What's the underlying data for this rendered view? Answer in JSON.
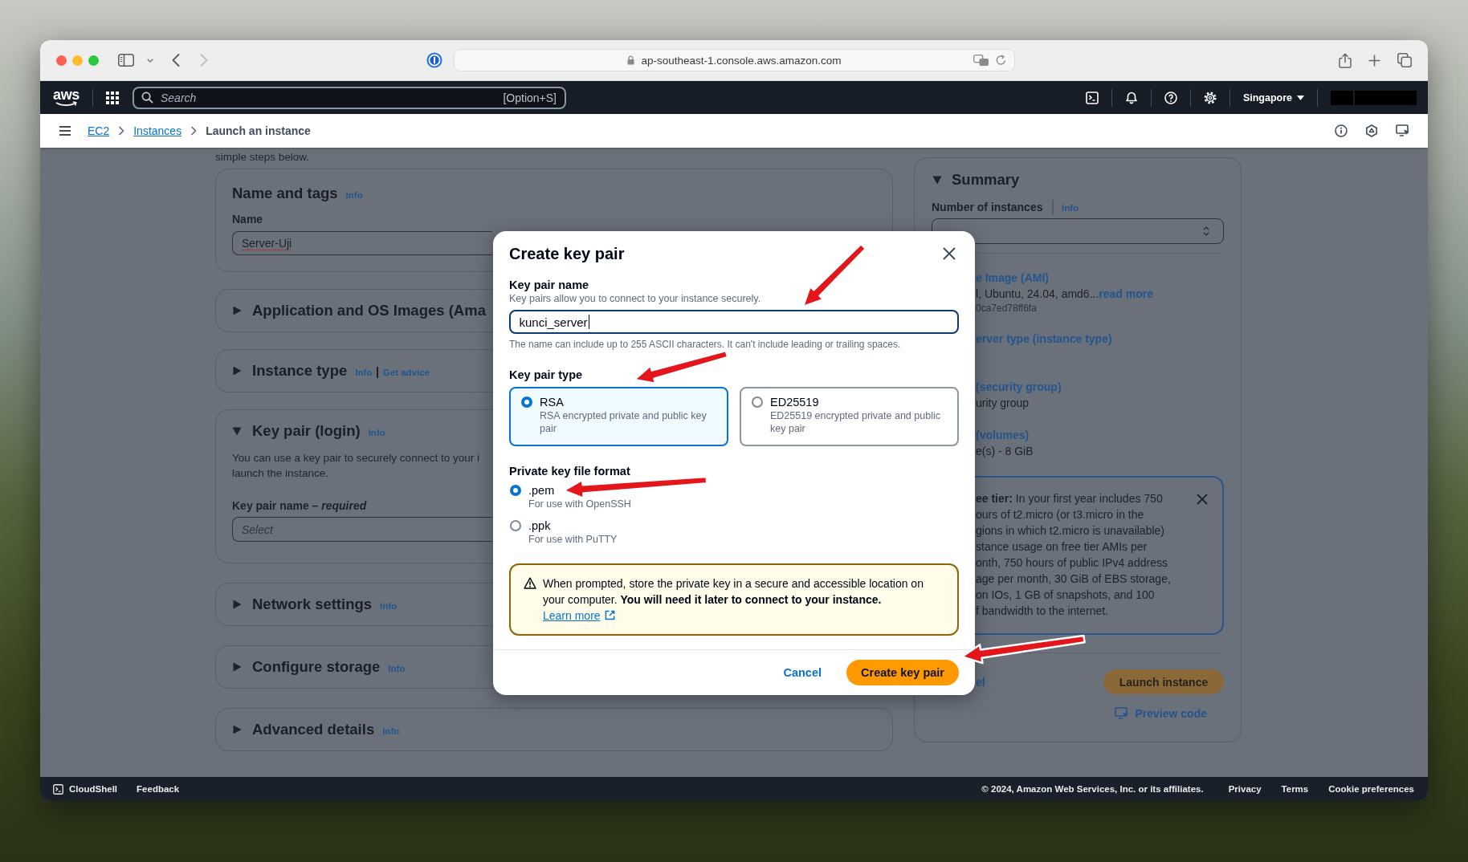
{
  "browser": {
    "nav_buttons": [
      {
        "kind": "back",
        "disabled": false
      },
      {
        "kind": "forward",
        "disabled": true
      }
    ],
    "url": "ap-southeast-1.console.aws.amazon.com"
  },
  "top_nav": {
    "logo": "aws",
    "search": {
      "placeholder": "Search",
      "shortcut": "[Option+S]"
    },
    "region": "Singapore"
  },
  "breadcrumbs": [
    {
      "label": "EC2",
      "kind": "link"
    },
    {
      "label": "Instances",
      "kind": "link"
    },
    {
      "label": "Launch an instance",
      "kind": "current"
    }
  ],
  "intro": "simple steps below.",
  "sections": [
    {
      "kind": "name",
      "title": "Name and tags",
      "info": "Info",
      "field_label": "Name",
      "value": "Server-Uji",
      "misspelled": true
    },
    {
      "kind": "collapsible",
      "title": "Application and OS Images (Ama",
      "expanded": false
    },
    {
      "kind": "collapsible",
      "title": "Instance type",
      "expanded": false,
      "info": "Info",
      "link": "Get advice"
    },
    {
      "kind": "collapsible",
      "title": "Key pair (login)",
      "expanded": true,
      "info": "Info",
      "description": [
        "You can use a key pair to securely connect to your i",
        "launch the instance."
      ],
      "field_label": "Key pair name – *required*",
      "placeholder": "Select"
    },
    {
      "kind": "collapsible",
      "title": "Network settings",
      "expanded": false,
      "info": "Info"
    },
    {
      "kind": "collapsible",
      "title": "Configure storage",
      "expanded": false,
      "info": "Info"
    },
    {
      "kind": "collapsible",
      "title": "Advanced details",
      "expanded": false,
      "info": "Info"
    }
  ],
  "summary": {
    "title": "Summary",
    "expanded": true,
    "count_label": "Number of instances",
    "info": "Info",
    "items": [
      {
        "heading": "e Image (AMI)",
        "text": "l, Ubuntu, 24.04, amd6...",
        "link": "read more",
        "sub": "0ca7ed78ff6fa"
      },
      {
        "heading": "erver type (instance type)"
      },
      {
        "heading": "(security group)",
        "text": "urity group"
      },
      {
        "heading": "(volumes)",
        "text": "e(s) - 8 GiB"
      }
    ],
    "free_tier": {
      "lines": [
        "**ee tier:** In your first year includes 750",
        "ours of t2.micro (or t3.micro in the",
        "gions in which t2.micro is unavailable)",
        "stance usage on free tier AMIs per",
        "onth, 750 hours of public IPv4 address",
        "age per month, 30 GiB of EBS storage,",
        "on IOs, 1 GB of snapshots, and 100",
        "f bandwidth to the internet."
      ],
      "dismissible": true
    },
    "cancel": "el",
    "launch": "Launch instance",
    "preview": "Preview code"
  },
  "modal": {
    "title": "Create key pair",
    "name_label": "Key pair name",
    "name_description": "Key pairs allow you to connect to your instance securely.",
    "name_value": "kunci_server",
    "name_focused": true,
    "name_hint": "The name can include up to 255 ASCII characters. It can't include leading or trailing spaces.",
    "type_label": "Key pair type",
    "types": [
      {
        "label": "RSA",
        "description": "RSA encrypted private and public key pair",
        "selected": true
      },
      {
        "label": "ED25519",
        "description": "ED25519 encrypted private and public key pair",
        "selected": false
      }
    ],
    "format_label": "Private key file format",
    "formats": [
      {
        "label": ".pem",
        "description": "For use with OpenSSH",
        "selected": true
      },
      {
        "label": ".ppk",
        "description": "For use with PuTTY",
        "selected": false
      }
    ],
    "alert": {
      "kind": "warning",
      "text": "When prompted, store the private key in a secure and accessible location on your computer. **You will need it later to connect to your instance.**",
      "link": "Learn more"
    },
    "buttons": [
      {
        "label": "Cancel",
        "kind": "link"
      },
      {
        "label": "Create key pair",
        "kind": "primary"
      }
    ]
  },
  "footer": {
    "cloudshell": "CloudShell",
    "feedback": "Feedback",
    "copyright": "© 2024, Amazon Web Services, Inc. or its affiliates.",
    "links": [
      "Privacy",
      "Terms",
      "Cookie preferences"
    ]
  }
}
